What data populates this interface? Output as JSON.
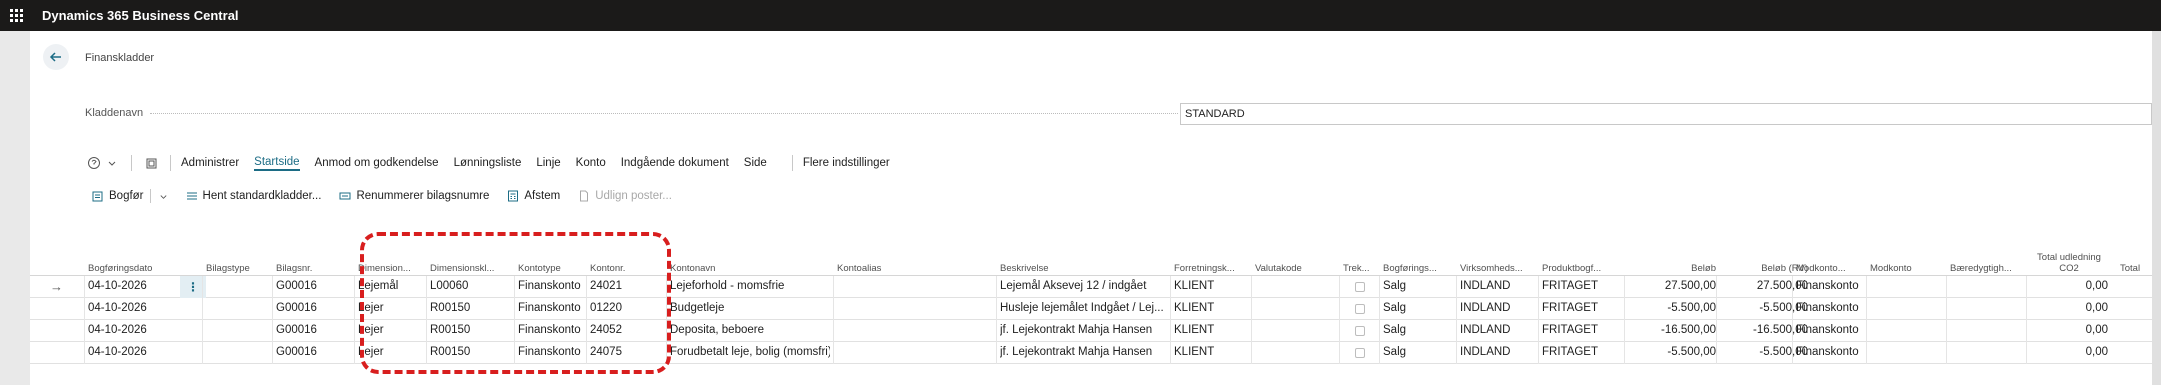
{
  "app": {
    "title": "Dynamics 365 Business Central"
  },
  "page": {
    "caption": "Finanskladder",
    "field_label": "Kladdenavn",
    "field_value": "STANDARD"
  },
  "actions": [
    "Administrer",
    "Startside",
    "Anmod om godkendelse",
    "Lønningsliste",
    "Linje",
    "Konto",
    "Indgående dokument",
    "Side",
    "Flere indstillinger"
  ],
  "active_action": "Startside",
  "subactions": {
    "post": "Bogfør",
    "get_standard": "Hent standardkladder...",
    "renumber": "Renummerer bilagsnumre",
    "reconcile": "Afstem",
    "apply": "Udlign poster..."
  },
  "columns": [
    "Bogføringsdato",
    "Bilagstype",
    "Bilagsnr.",
    "Dimension...",
    "Dimensionskl...",
    "Kontotype",
    "Kontonr.",
    "Kontonavn",
    "Kontoalias",
    "Beskrivelse",
    "Forretningsk...",
    "Valutakode",
    "Trek...",
    "Bogførings...",
    "Virksomheds...",
    "Produktbogf...",
    "Beløb",
    "Beløb (RV)",
    "Modkonto...",
    "Modkonto",
    "Bæredygtigh...",
    "Total udledning CO2",
    "Total"
  ],
  "rows": [
    [
      "04-10-2026",
      "",
      "G00016",
      "Lejemål",
      "L00060",
      "Finanskonto",
      "24021",
      "Lejeforhold - momsfrie",
      "",
      "Lejemål Aksevej 12 / indgået",
      "KLIENT",
      "",
      "",
      "Salg",
      "INDLAND",
      "FRITAGET",
      "27.500,00",
      "27.500,00",
      "Finanskonto",
      "",
      "",
      "0,00"
    ],
    [
      "04-10-2026",
      "",
      "G00016",
      "Lejer",
      "R00150",
      "Finanskonto",
      "01220",
      "Budgetleje",
      "",
      "Husleje lejemålet Indgået / Lej...",
      "KLIENT",
      "",
      "",
      "Salg",
      "INDLAND",
      "FRITAGET",
      "-5.500,00",
      "-5.500,00",
      "Finanskonto",
      "",
      "",
      "0,00"
    ],
    [
      "04-10-2026",
      "",
      "G00016",
      "Lejer",
      "R00150",
      "Finanskonto",
      "24052",
      "Deposita, beboere",
      "",
      "jf. Lejekontrakt Mahja Hansen",
      "KLIENT",
      "",
      "",
      "Salg",
      "INDLAND",
      "FRITAGET",
      "-16.500,00",
      "-16.500,00",
      "Finanskonto",
      "",
      "",
      "0,00"
    ],
    [
      "04-10-2026",
      "",
      "G00016",
      "Lejer",
      "R00150",
      "Finanskonto",
      "24075",
      "Forudbetalt leje, bolig (momsfri)",
      "",
      "jf. Lejekontrakt Mahja Hansen",
      "KLIENT",
      "",
      "",
      "Salg",
      "INDLAND",
      "FRITAGET",
      "-5.500,00",
      "-5.500,00",
      "Finanskonto",
      "",
      "",
      "0,00"
    ]
  ],
  "colors": {
    "accent": "#1c6c85",
    "highlight": "#d81e1e",
    "topbar": "#1b1a19"
  }
}
